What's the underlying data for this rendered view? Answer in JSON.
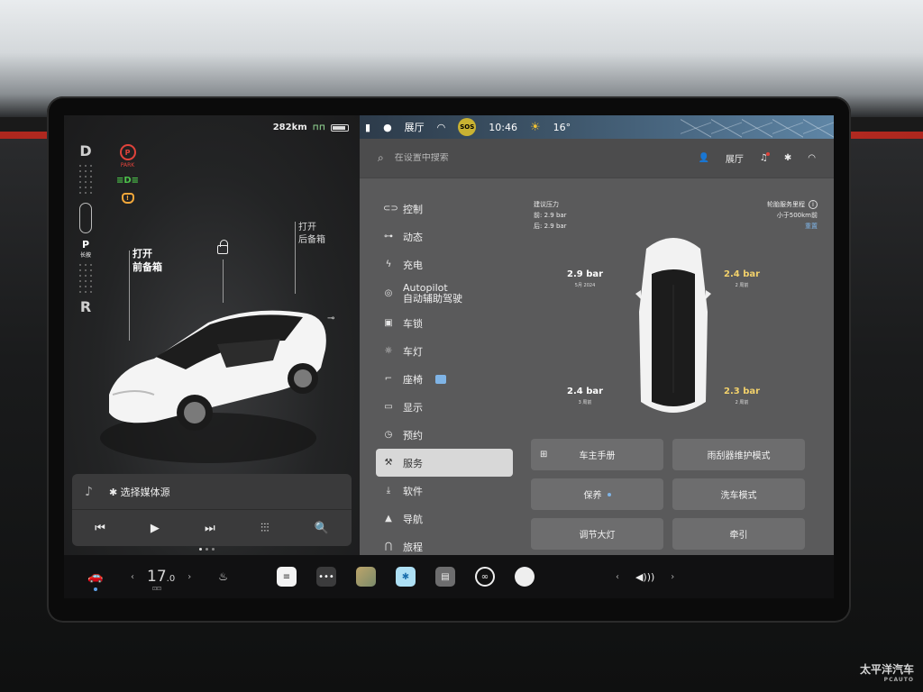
{
  "status": {
    "range": "282km"
  },
  "gears": {
    "d": "D",
    "p": "P",
    "p_sub": "长按",
    "r": "R"
  },
  "indicators": {
    "park_label": "PARK",
    "park_symbol": "P"
  },
  "left_view": {
    "frunk": "打开\n前备箱",
    "trunk": "打开\n后备箱"
  },
  "media": {
    "source_label": "✱ 选择媒体源",
    "prev": "⏮",
    "play": "▶",
    "next": "⏭",
    "eq": "⫶⫶⫶",
    "search": "🔍"
  },
  "map_bar": {
    "location": "展厅",
    "sos": "SOS",
    "time": "10:46",
    "temp": "16°"
  },
  "settings": {
    "search_placeholder": "在设置中搜索",
    "profile": "展厅"
  },
  "menu": [
    {
      "icon": "toggle-icon",
      "glyph": "⊂⊃",
      "label": "控制"
    },
    {
      "icon": "car-icon",
      "glyph": "⊶",
      "label": "动态"
    },
    {
      "icon": "bolt-icon",
      "glyph": "ϟ",
      "label": "充电"
    },
    {
      "icon": "steering-icon",
      "glyph": "◎",
      "label": "Autopilot\n自动辅助驾驶"
    },
    {
      "icon": "lock-icon",
      "glyph": "▣",
      "label": "车锁"
    },
    {
      "icon": "light-icon",
      "glyph": "☼",
      "label": "车灯"
    },
    {
      "icon": "seat-icon",
      "glyph": "⌐",
      "label": "座椅"
    },
    {
      "icon": "display-icon",
      "glyph": "▭",
      "label": "显示"
    },
    {
      "icon": "clock-icon",
      "glyph": "◷",
      "label": "预约"
    },
    {
      "icon": "wrench-icon",
      "glyph": "⚒",
      "label": "服务"
    },
    {
      "icon": "download-icon",
      "glyph": "⤓",
      "label": "软件"
    },
    {
      "icon": "nav-icon",
      "glyph": "▲",
      "label": "导航"
    },
    {
      "icon": "trip-icon",
      "glyph": "⋂",
      "label": "旅程"
    }
  ],
  "active_menu": "服务",
  "tire": {
    "rec_title": "建议压力",
    "rec_front": "前: 2.9 bar",
    "rec_rear": "后: 2.9 bar",
    "service_title": "轮胎服务里程",
    "service_value": "小于500km前",
    "reset": "重置",
    "info": "i",
    "fl": {
      "value": "2.9 bar",
      "sub": "5月 2024"
    },
    "fr": {
      "value": "2.4 bar",
      "sub": "2 周前"
    },
    "rl": {
      "value": "2.4 bar",
      "sub": "3 周前"
    },
    "rr": {
      "value": "2.3 bar",
      "sub": "2 周前"
    }
  },
  "service_buttons": {
    "manual": "车主手册",
    "wiper": "雨刮器维护模式",
    "maintenance": "保养",
    "carwash": "洗车模式",
    "headlights": "调节大灯",
    "tow": "牵引"
  },
  "taskbar": {
    "temp_whole": "17",
    "temp_dec": ".0",
    "left_arrow": "‹",
    "right_arrow": "›"
  },
  "watermark": {
    "brand": "太平洋汽车",
    "sub": "PCAUTO"
  },
  "colors": {
    "warning_red": "#e0433b",
    "warning_amber": "#f2a73a",
    "headlight_green": "#4cc24a",
    "accent_blue": "#7fb4e6",
    "tire_warn_yellow": "#f2d16b"
  }
}
